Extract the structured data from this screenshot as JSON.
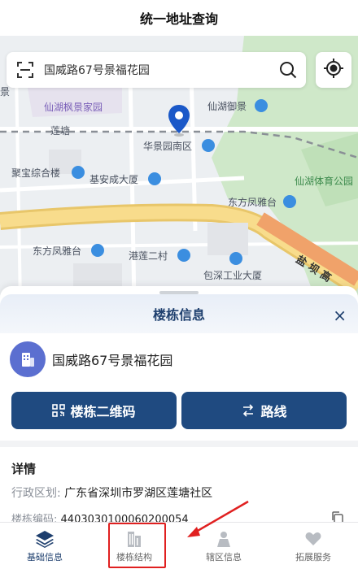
{
  "app": {
    "title": "统一地址查询"
  },
  "search": {
    "query": "国威路67号景福花园"
  },
  "map": {
    "labels": {
      "xianhu_fengjing": "仙湖枫景家园",
      "xianhu_yushu": "仙湖御景",
      "lianjing": "莲塘",
      "huajingyuan": "华景园南区",
      "jubao": "聚宝综合楼",
      "jiaanchen": "基安成大厦",
      "xianhu_tiyu": "仙湖体育公园",
      "dongfang_1": "东方凤雅台",
      "dongfang_2": "东方凤雅台",
      "ganglian": "港莲二村",
      "baochuang": "包深工业大厦",
      "road": "盐 坝 高",
      "edge_left": "景"
    },
    "colors": {
      "pin": "#1a58c8",
      "poi_blue": "#3b8ee0",
      "road": "#f6d27a"
    }
  },
  "sheet": {
    "title": "楼栋信息",
    "close_icon": "×",
    "building_name": "国威路67号景福花园",
    "btn_qr": "楼栋二维码",
    "btn_route": "路线",
    "details_title": "详情",
    "rows": [
      {
        "key": "行政区划:",
        "value": "广东省深圳市罗湖区莲塘社区"
      },
      {
        "key": "楼栋编码:",
        "value": "4403030100060200054"
      }
    ]
  },
  "tabs": [
    {
      "label": "基础信息",
      "icon": "layers-icon",
      "active": true
    },
    {
      "label": "楼栋结构",
      "icon": "buildings-icon",
      "active": false
    },
    {
      "label": "辖区信息",
      "icon": "map-person-icon",
      "active": false
    },
    {
      "label": "拓展服务",
      "icon": "heart-hand-icon",
      "active": false
    }
  ],
  "colors": {
    "primary": "#1f4a80",
    "highlight": "#e02020"
  }
}
